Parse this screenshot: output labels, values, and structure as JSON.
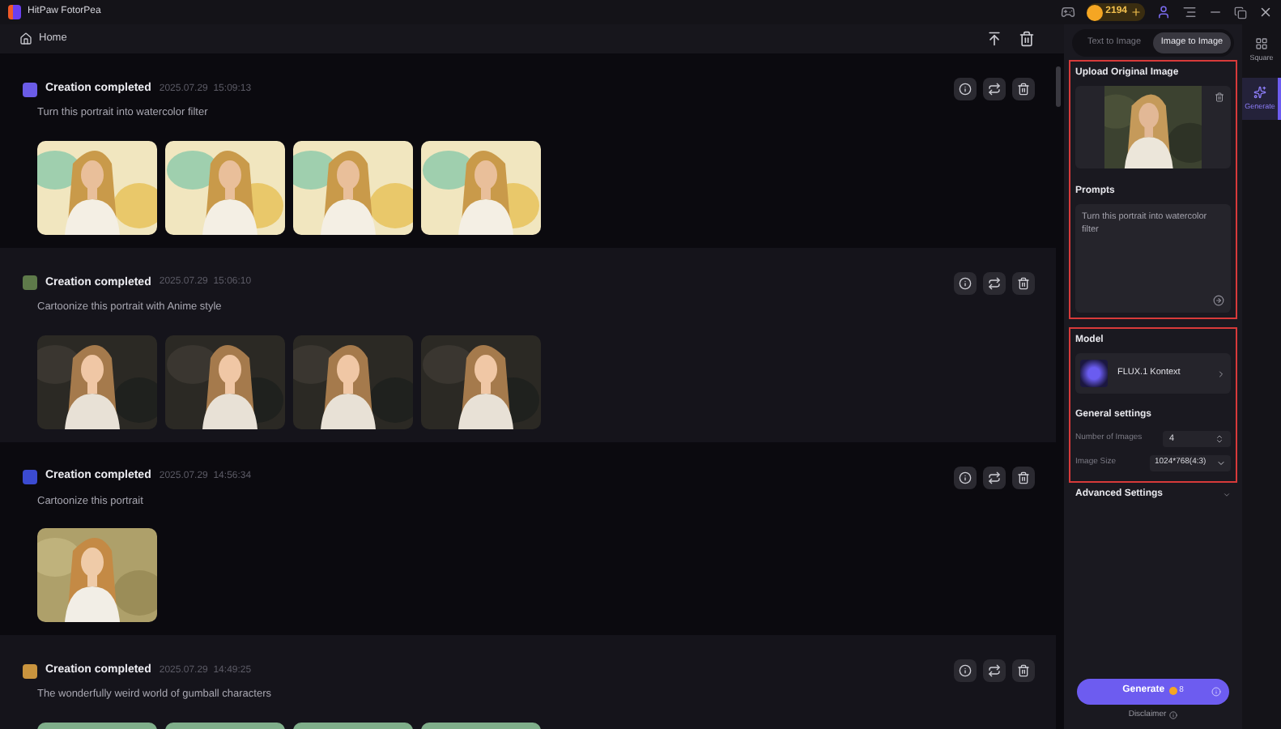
{
  "window": {
    "title": "HitPaw FotorPea",
    "coins": "2194"
  },
  "breadcrumb": "Home",
  "feed": [
    {
      "status": "Creation completed",
      "datetime": "2025.07.29  15:09:13",
      "prompt": "Turn this portrait into watercolor filter"
    },
    {
      "status": "Creation completed",
      "datetime": "2025.07.29  15:06:10",
      "prompt": "Cartoonize this portrait with Anime style"
    },
    {
      "status": "Creation completed",
      "datetime": "2025.07.29  14:56:34",
      "prompt": "Cartoonize this portrait"
    },
    {
      "status": "Creation completed",
      "datetime": "2025.07.29  14:49:25",
      "prompt": "The wonderfully weird world of gumball characters"
    }
  ],
  "panel": {
    "tabs": [
      {
        "label": "Text to Image",
        "selected": false
      },
      {
        "label": "Image to Image",
        "selected": true
      }
    ],
    "upload": {
      "title": "Upload Original Image"
    },
    "prompts": {
      "title": "Prompts",
      "value": "Turn this portrait into watercolor filter"
    },
    "model": {
      "title": "Model",
      "name": "FLUX.1 Kontext"
    },
    "general": {
      "title": "General settings",
      "number_of_images": {
        "label": "Number of Images",
        "value": "4"
      },
      "image_size": {
        "label": "Image Size",
        "value": "1024*768(4:3)"
      }
    },
    "advanced": "Advanced Settings",
    "generate": {
      "label": "Generate",
      "cost": "8"
    },
    "disclaimer": "Disclaimer"
  },
  "rail": [
    {
      "label": "Square",
      "selected": false
    },
    {
      "label": "Generate",
      "selected": true
    }
  ]
}
